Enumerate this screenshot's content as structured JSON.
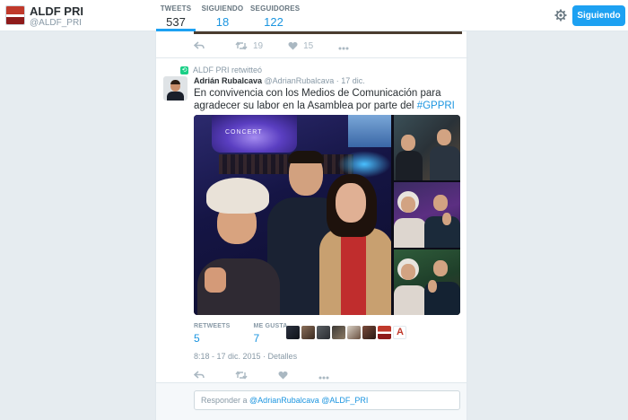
{
  "profile": {
    "name": "ALDF PRI",
    "handle": "@ALDF_PRI"
  },
  "nav": {
    "tweets": {
      "label": "TWEETS",
      "value": "537"
    },
    "following": {
      "label": "SIGUIENDO",
      "value": "18"
    },
    "followers": {
      "label": "SEGUIDORES",
      "value": "122"
    },
    "settings_icon": "gear-icon",
    "follow_button": "Siguiendo"
  },
  "prev_tweet": {
    "retweets": "19",
    "likes": "15"
  },
  "tweet": {
    "retweet_note": "ALDF PRI retwitteó",
    "author": "Adrián Rubalcava",
    "author_handle": "@AdrianRubalcava",
    "date": "17 dic.",
    "text_main": "En convivencia con los Medios de Comunicación para agradecer su labor en la Asamblea por parte del ",
    "hashtag": "#GPPRI",
    "stats": {
      "retweets_label": "RETWEETS",
      "retweets_value": "5",
      "likes_label": "ME GUSTA",
      "likes_value": "7"
    },
    "timestamp": "8:18 - 17 dic. 2015 · Detalles",
    "likers_count": 8
  },
  "reply": {
    "prefix": "Responder a ",
    "mentions": "@AdrianRubalcava @ALDF_PRI"
  },
  "colors": {
    "accent": "#1da1f2",
    "link": "#1b95e0",
    "retweet_green": "#19cf86"
  }
}
